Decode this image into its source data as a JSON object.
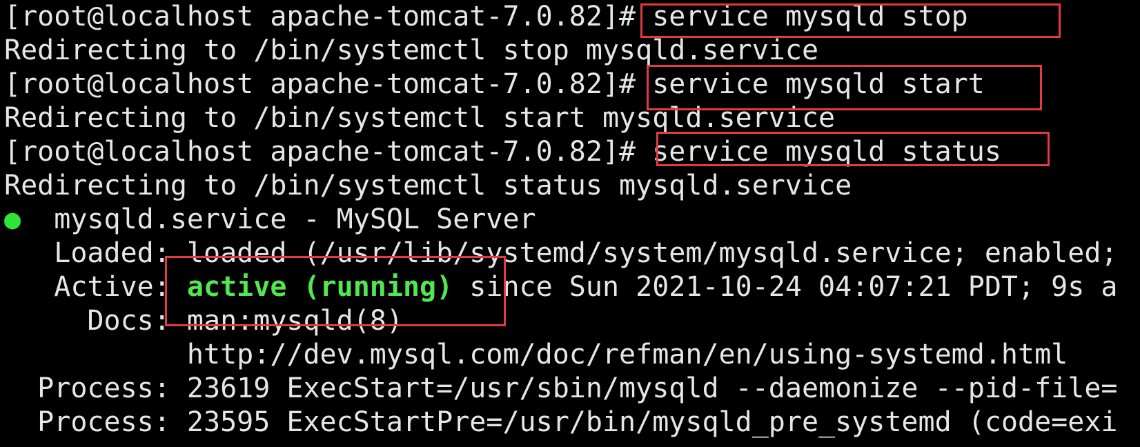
{
  "terminal": {
    "lines": [
      {
        "prompt": "[root@localhost apache-tomcat-7.0.82]#",
        "command": " service mysqld stop"
      },
      {
        "output": "Redirecting to /bin/systemctl stop mysqld.service"
      },
      {
        "prompt": "[root@localhost apache-tomcat-7.0.82]#",
        "command": " service mysqld start"
      },
      {
        "output": "Redirecting to /bin/systemctl start mysqld.service"
      },
      {
        "prompt": "[root@localhost apache-tomcat-7.0.82]#",
        "command": " service mysqld status"
      },
      {
        "output": "Redirecting to /bin/systemctl status mysqld.service"
      },
      {
        "bullet": "●",
        "output": "  mysqld.service - MySQL Server"
      },
      {
        "output": "   Loaded: loaded (/usr/lib/systemd/system/mysqld.service; enabled;"
      },
      {
        "label": "   Active: ",
        "status": "active (running)",
        "output": " since Sun 2021-10-24 04:07:21 PDT; 9s a"
      },
      {
        "output": "     Docs: man:mysqld(8)"
      },
      {
        "output": "           http://dev.mysql.com/doc/refman/en/using-systemd.html"
      },
      {
        "output": "  Process: 23619 ExecStart=/usr/sbin/mysqld --daemonize --pid-file="
      },
      {
        "output": "  Process: 23595 ExecStartPre=/usr/bin/mysqld_pre_systemd (code=exi"
      }
    ]
  },
  "colors": {
    "background": "#000000",
    "text": "#e6e6e6",
    "status_active": "#52e652",
    "bullet": "#2ee63a",
    "highlight_box": "#e43b43"
  }
}
